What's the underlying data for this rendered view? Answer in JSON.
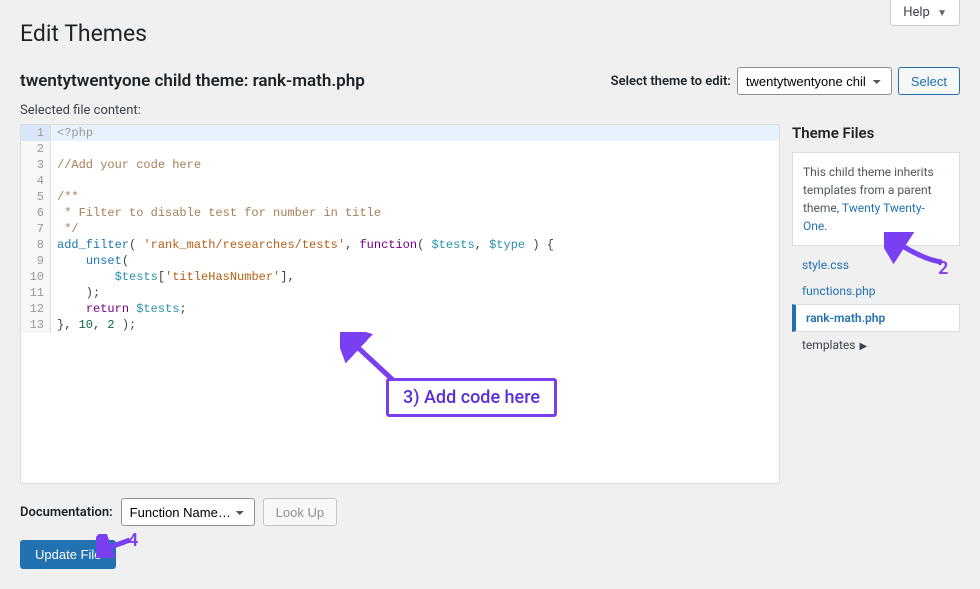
{
  "help": {
    "label": "Help"
  },
  "page_title": "Edit Themes",
  "file_heading": "twentytwentyone child theme: rank-math.php",
  "theme_select": {
    "label": "Select theme to edit:",
    "selected": "twentytwentyone chil",
    "button": "Select"
  },
  "selected_file_label": "Selected file content:",
  "code": {
    "lines": [
      {
        "n": 1,
        "raw": "<?php",
        "tokens": [
          [
            "meta",
            "<?php"
          ]
        ]
      },
      {
        "n": 2,
        "raw": "",
        "tokens": []
      },
      {
        "n": 3,
        "raw": "//Add your code here",
        "tokens": [
          [
            "comment",
            "//Add your code here"
          ]
        ]
      },
      {
        "n": 4,
        "raw": "",
        "tokens": []
      },
      {
        "n": 5,
        "raw": "/**",
        "tokens": [
          [
            "comment",
            "/**"
          ]
        ]
      },
      {
        "n": 6,
        "raw": " * Filter to disable test for number in title",
        "tokens": [
          [
            "comment",
            " * Filter to disable test for number in title"
          ]
        ]
      },
      {
        "n": 7,
        "raw": " */",
        "tokens": [
          [
            "comment",
            " */"
          ]
        ]
      },
      {
        "n": 8,
        "raw": "add_filter( 'rank_math/researches/tests', function( $tests, $type ) {",
        "tokens": [
          [
            "func",
            "add_filter"
          ],
          [
            "plain",
            "( "
          ],
          [
            "str",
            "'rank_math/researches/tests'"
          ],
          [
            "plain",
            ", "
          ],
          [
            "kw",
            "function"
          ],
          [
            "plain",
            "( "
          ],
          [
            "var",
            "$tests"
          ],
          [
            "plain",
            ", "
          ],
          [
            "var",
            "$type"
          ],
          [
            "plain",
            " ) {"
          ]
        ]
      },
      {
        "n": 9,
        "raw": "    unset(",
        "tokens": [
          [
            "plain",
            "    "
          ],
          [
            "func",
            "unset"
          ],
          [
            "plain",
            "("
          ]
        ]
      },
      {
        "n": 10,
        "raw": "        $tests['titleHasNumber'],",
        "tokens": [
          [
            "plain",
            "        "
          ],
          [
            "var",
            "$tests"
          ],
          [
            "plain",
            "["
          ],
          [
            "str",
            "'titleHasNumber'"
          ],
          [
            "plain",
            "],"
          ]
        ]
      },
      {
        "n": 11,
        "raw": "    );",
        "tokens": [
          [
            "plain",
            "    );"
          ]
        ]
      },
      {
        "n": 12,
        "raw": "    return $tests;",
        "tokens": [
          [
            "plain",
            "    "
          ],
          [
            "kw",
            "return"
          ],
          [
            "plain",
            " "
          ],
          [
            "var",
            "$tests"
          ],
          [
            "plain",
            ";"
          ]
        ]
      },
      {
        "n": 13,
        "raw": "}, 10, 2 );",
        "tokens": [
          [
            "plain",
            "}, "
          ],
          [
            "num",
            "10"
          ],
          [
            "plain",
            ", "
          ],
          [
            "num",
            "2"
          ],
          [
            "plain",
            " );"
          ]
        ]
      }
    ],
    "active_line": 1
  },
  "sidebar": {
    "heading": "Theme Files",
    "desc_pre": "This child theme inherits templates from a parent theme, ",
    "desc_link": "Twenty Twenty-One",
    "desc_post": ".",
    "files": [
      {
        "label": "style.css",
        "current": false,
        "folder": false
      },
      {
        "label": "functions.php",
        "current": false,
        "folder": false
      },
      {
        "label": "rank-math.php",
        "current": true,
        "folder": false
      },
      {
        "label": "templates",
        "current": false,
        "folder": true
      }
    ]
  },
  "documentation": {
    "label": "Documentation:",
    "selected": "Function Name…",
    "lookup": "Look Up"
  },
  "submit": {
    "label": "Update File"
  },
  "annotations": {
    "arrow2_num": "2",
    "box3": "3) Add code here",
    "arrow4_num": "4"
  }
}
